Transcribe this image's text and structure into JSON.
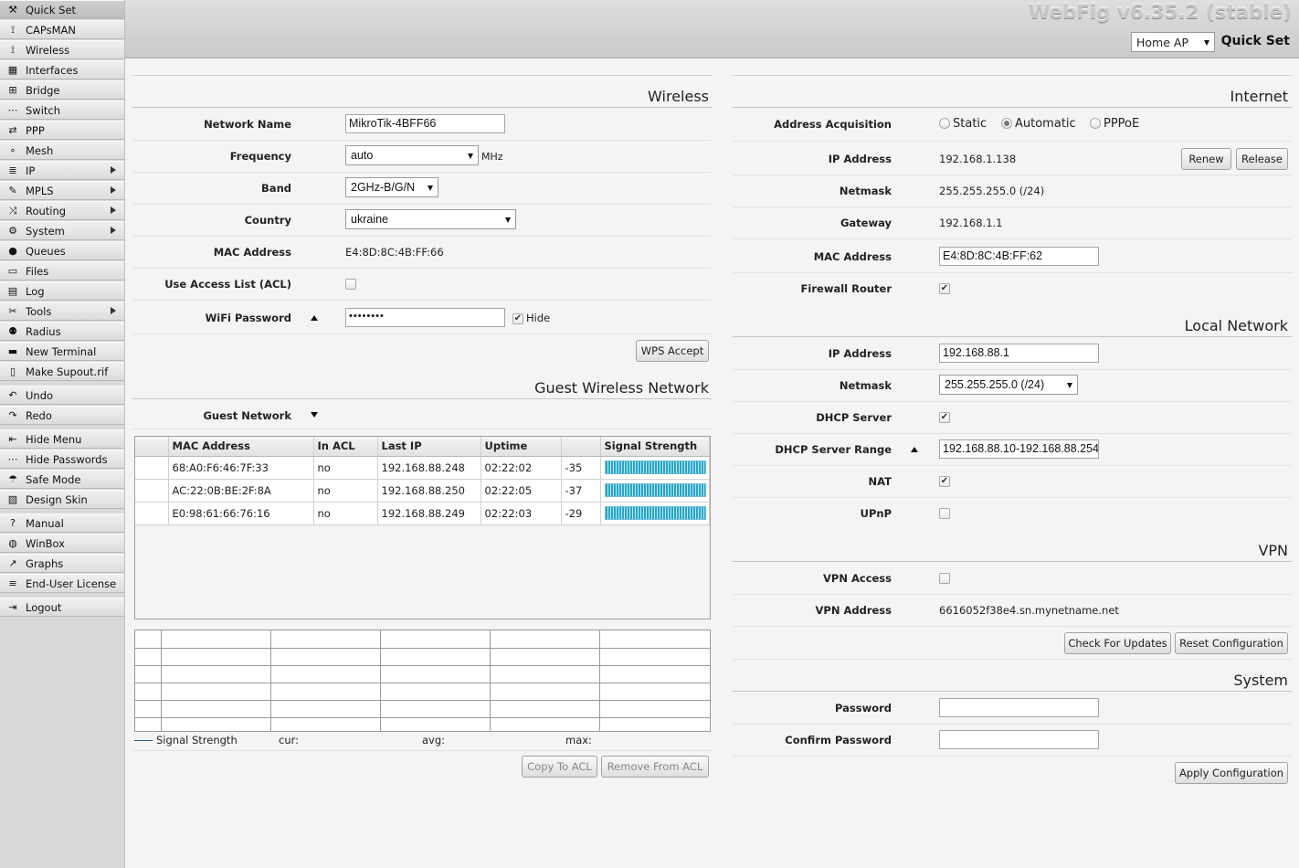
{
  "header": {
    "brand": "WebFig v6.35.2 (stable)",
    "mode_value": "Home AP",
    "mode_label": "Quick Set"
  },
  "sidebar": {
    "items": [
      {
        "label": "Quick Set",
        "icon": "quick-set-icon",
        "submenu": false
      },
      {
        "label": "CAPsMAN",
        "icon": "antenna-icon",
        "submenu": false
      },
      {
        "label": "Wireless",
        "icon": "antenna-icon",
        "submenu": false
      },
      {
        "label": "Interfaces",
        "icon": "interfaces-icon",
        "submenu": false
      },
      {
        "label": "Bridge",
        "icon": "bridge-icon",
        "submenu": false
      },
      {
        "label": "Switch",
        "icon": "switch-icon",
        "submenu": false
      },
      {
        "label": "PPP",
        "icon": "ppp-icon",
        "submenu": false
      },
      {
        "label": "Mesh",
        "icon": "mesh-icon",
        "submenu": false
      },
      {
        "label": "IP",
        "icon": "ip-icon",
        "submenu": true
      },
      {
        "label": "MPLS",
        "icon": "mpls-icon",
        "submenu": true
      },
      {
        "label": "Routing",
        "icon": "routing-icon",
        "submenu": true
      },
      {
        "label": "System",
        "icon": "gear-icon",
        "submenu": true
      },
      {
        "label": "Queues",
        "icon": "queues-icon",
        "submenu": false
      },
      {
        "label": "Files",
        "icon": "folder-icon",
        "submenu": false
      },
      {
        "label": "Log",
        "icon": "log-icon",
        "submenu": false
      },
      {
        "label": "Tools",
        "icon": "tools-icon",
        "submenu": true
      },
      {
        "label": "Radius",
        "icon": "radius-icon",
        "submenu": false
      },
      {
        "label": "New Terminal",
        "icon": "terminal-icon",
        "submenu": false
      },
      {
        "label": "Make Supout.rif",
        "icon": "document-icon",
        "submenu": false
      },
      {
        "label": "Undo",
        "icon": "undo-icon",
        "submenu": false
      },
      {
        "label": "Redo",
        "icon": "redo-icon",
        "submenu": false
      },
      {
        "label": "Hide Menu",
        "icon": "hide-menu-icon",
        "submenu": false
      },
      {
        "label": "Hide Passwords",
        "icon": "password-icon",
        "submenu": false
      },
      {
        "label": "Safe Mode",
        "icon": "umbrella-icon",
        "submenu": false
      },
      {
        "label": "Design Skin",
        "icon": "skin-icon",
        "submenu": false
      },
      {
        "label": "Manual",
        "icon": "help-icon",
        "submenu": false
      },
      {
        "label": "WinBox",
        "icon": "globe-icon",
        "submenu": false
      },
      {
        "label": "Graphs",
        "icon": "graph-icon",
        "submenu": false
      },
      {
        "label": "End-User License",
        "icon": "license-icon",
        "submenu": false
      },
      {
        "label": "Logout",
        "icon": "logout-icon",
        "submenu": false
      }
    ]
  },
  "wireless": {
    "title": "Wireless",
    "network_name_label": "Network Name",
    "network_name_value": "MikroTik-4BFF66",
    "frequency_label": "Frequency",
    "frequency_value": "auto",
    "frequency_unit": "MHz",
    "band_label": "Band",
    "band_value": "2GHz-B/G/N",
    "country_label": "Country",
    "country_value": "ukraine",
    "mac_label": "MAC Address",
    "mac_value": "E4:8D:8C:4B:FF:66",
    "acl_label": "Use Access List (ACL)",
    "acl_checked": false,
    "password_label": "WiFi Password",
    "password_value": "••••••••",
    "hide_label": "Hide",
    "hide_checked": true,
    "wps_button": "WPS Accept"
  },
  "guest": {
    "title": "Guest Wireless Network",
    "guest_network_label": "Guest Network"
  },
  "clients_table": {
    "columns": [
      "MAC Address",
      "In ACL",
      "Last IP",
      "Uptime",
      "",
      "Signal Strength"
    ],
    "rows": [
      {
        "mac": "68:A0:F6:46:7F:33",
        "acl": "no",
        "ip": "192.168.88.248",
        "uptime": "02:22:02",
        "signal": "-35"
      },
      {
        "mac": "AC:22:0B:BE:2F:8A",
        "acl": "no",
        "ip": "192.168.88.250",
        "uptime": "02:22:05",
        "signal": "-37"
      },
      {
        "mac": "E0:98:61:66:76:16",
        "acl": "no",
        "ip": "192.168.88.249",
        "uptime": "02:22:03",
        "signal": "-29"
      }
    ]
  },
  "graph": {
    "legend": "Signal Strength",
    "cur_label": "cur:",
    "avg_label": "avg:",
    "max_label": "max:",
    "copy_button": "Copy To ACL",
    "remove_button": "Remove From ACL"
  },
  "internet": {
    "title": "Internet",
    "acq_label": "Address Acquisition",
    "acq_options": [
      "Static",
      "Automatic",
      "PPPoE"
    ],
    "acq_selected": "Automatic",
    "ip_label": "IP Address",
    "ip_value": "192.168.1.138",
    "renew_button": "Renew",
    "release_button": "Release",
    "netmask_label": "Netmask",
    "netmask_value": "255.255.255.0 (/24)",
    "gateway_label": "Gateway",
    "gateway_value": "192.168.1.1",
    "mac_label": "MAC Address",
    "mac_value": "E4:8D:8C:4B:FF:62",
    "firewall_label": "Firewall Router",
    "firewall_checked": true
  },
  "local": {
    "title": "Local Network",
    "ip_label": "IP Address",
    "ip_value": "192.168.88.1",
    "netmask_label": "Netmask",
    "netmask_value": "255.255.255.0 (/24)",
    "dhcp_label": "DHCP Server",
    "dhcp_checked": true,
    "range_label": "DHCP Server Range",
    "range_value": "192.168.88.10-192.168.88.254",
    "nat_label": "NAT",
    "nat_checked": true,
    "upnp_label": "UPnP",
    "upnp_checked": false
  },
  "vpn": {
    "title": "VPN",
    "access_label": "VPN Access",
    "access_checked": false,
    "address_label": "VPN Address",
    "address_value": "6616052f38e4.sn.mynetname.net",
    "check_updates_button": "Check For Updates",
    "reset_button": "Reset Configuration"
  },
  "system": {
    "title": "System",
    "password_label": "Password",
    "confirm_label": "Confirm Password",
    "apply_button": "Apply Configuration"
  },
  "colors": {
    "signal_bar": "#27a6c9",
    "graph_line": "#1f5fa8"
  }
}
